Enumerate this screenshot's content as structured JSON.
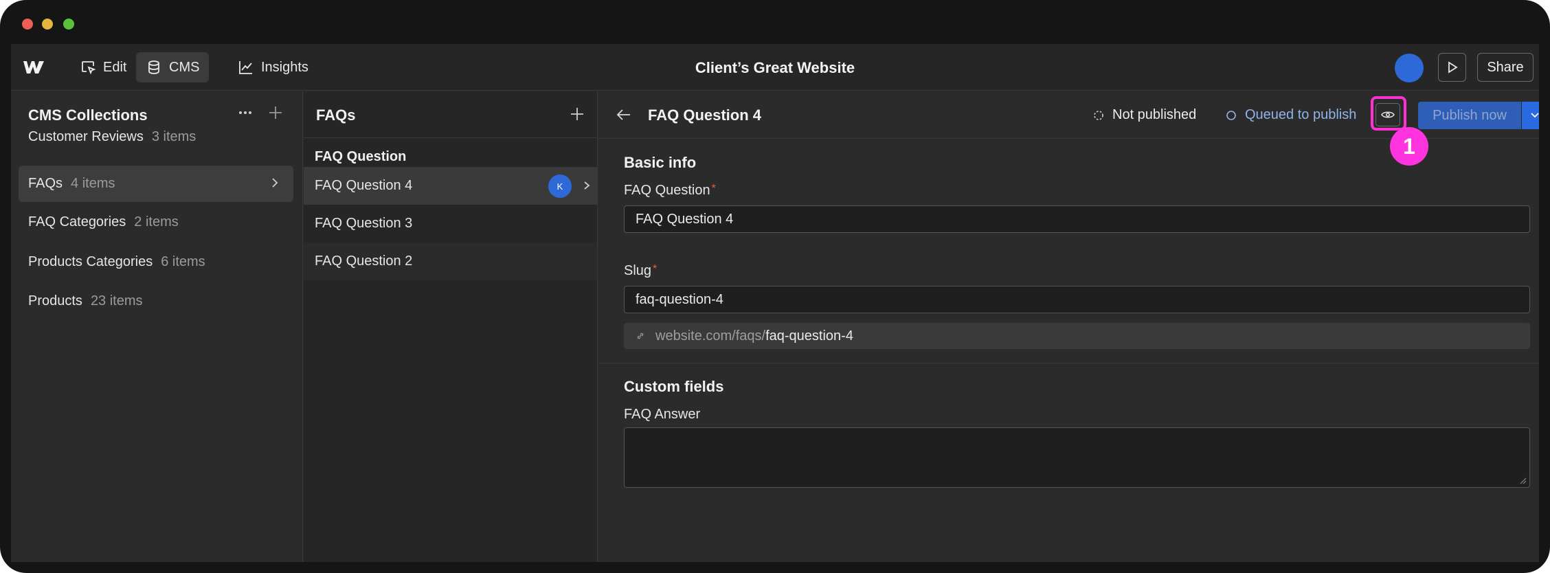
{
  "app": {
    "site_title": "Client’s Great Website",
    "nav": {
      "edit": "Edit",
      "cms": "CMS",
      "insights": "Insights"
    },
    "share_label": "Share"
  },
  "collections": {
    "title": "CMS Collections",
    "items": [
      {
        "name": "Customer Reviews",
        "count": "3 items"
      },
      {
        "name": "FAQs",
        "count": "4 items"
      },
      {
        "name": "FAQ Categories",
        "count": "2 items"
      },
      {
        "name": "Products Categories",
        "count": "6 items"
      },
      {
        "name": "Products",
        "count": "23 items"
      }
    ]
  },
  "items_list": {
    "title": "FAQs",
    "column_header": "FAQ Question",
    "rows": [
      {
        "label": "FAQ Question 4",
        "avatar": "K"
      },
      {
        "label": "FAQ Question 3"
      },
      {
        "label": "FAQ Question 2"
      }
    ]
  },
  "editor": {
    "title": "FAQ Question 4",
    "status_not_published": "Not published",
    "status_queued": "Queued to publish",
    "publish_label": "Publish now",
    "annotation_number": "1",
    "basic_info": {
      "title": "Basic info",
      "question_label": "FAQ Question",
      "question_value": "FAQ Question 4",
      "slug_label": "Slug",
      "slug_value": "faq-question-4",
      "url_prefix": "website.com/faqs/",
      "url_slug": "faq-question-4"
    },
    "custom_fields": {
      "title": "Custom fields",
      "answer_label": "FAQ Answer",
      "answer_value": ""
    }
  },
  "colors": {
    "accent_blue": "#2d6ad8",
    "highlight_pink": "#ff2fd6",
    "required_red": "#f05a4c"
  }
}
